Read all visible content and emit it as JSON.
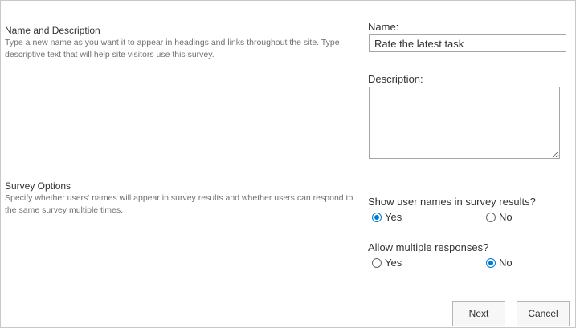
{
  "name_section": {
    "title": "Name and Description",
    "description": "Type a new name as you want it to appear in headings and links throughout the site. Type descriptive text that will help site visitors use this survey."
  },
  "name_field": {
    "label": "Name:",
    "value": "Rate the latest task"
  },
  "description_field": {
    "label": "Description:",
    "value": ""
  },
  "survey_section": {
    "title": "Survey Options",
    "description": "Specify whether users' names will appear in survey results and whether users can respond to the same survey multiple times."
  },
  "show_names": {
    "label": "Show user names in survey results?",
    "yes_label": "Yes",
    "no_label": "No",
    "selected": "yes"
  },
  "multiple_responses": {
    "label": "Allow multiple responses?",
    "yes_label": "Yes",
    "no_label": "No",
    "selected": "no"
  },
  "buttons": {
    "next": "Next",
    "cancel": "Cancel"
  },
  "colors": {
    "accent": "#0078d4"
  }
}
